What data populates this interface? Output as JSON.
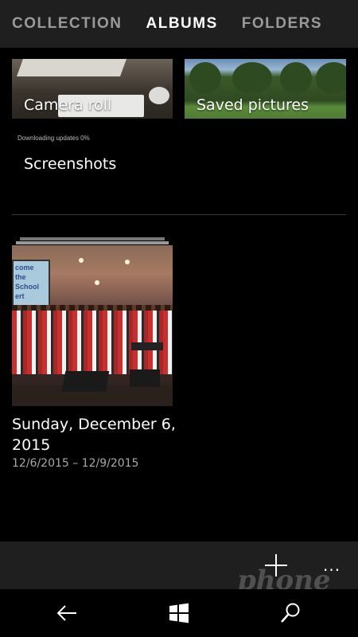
{
  "tabs": [
    {
      "label": "COLLECTION",
      "active": false
    },
    {
      "label": "ALBUMS",
      "active": true
    },
    {
      "label": "FOLDERS",
      "active": false
    }
  ],
  "albums": {
    "camera_roll": "Camera roll",
    "saved_pictures": "Saved pictures",
    "screenshots": "Screenshots"
  },
  "download_status": "Downloading updates 0%",
  "event": {
    "title": "Sunday, December 6, 2015",
    "date_range": "12/6/2015 – 12/9/2015"
  },
  "appbar": {
    "add_icon": "plus-icon",
    "more_icon": "ellipsis-icon",
    "more_label": "..."
  },
  "navbar": {
    "back_icon": "back-arrow-icon",
    "home_icon": "windows-logo-icon",
    "search_icon": "search-icon"
  },
  "watermark": "Phone Scoop"
}
